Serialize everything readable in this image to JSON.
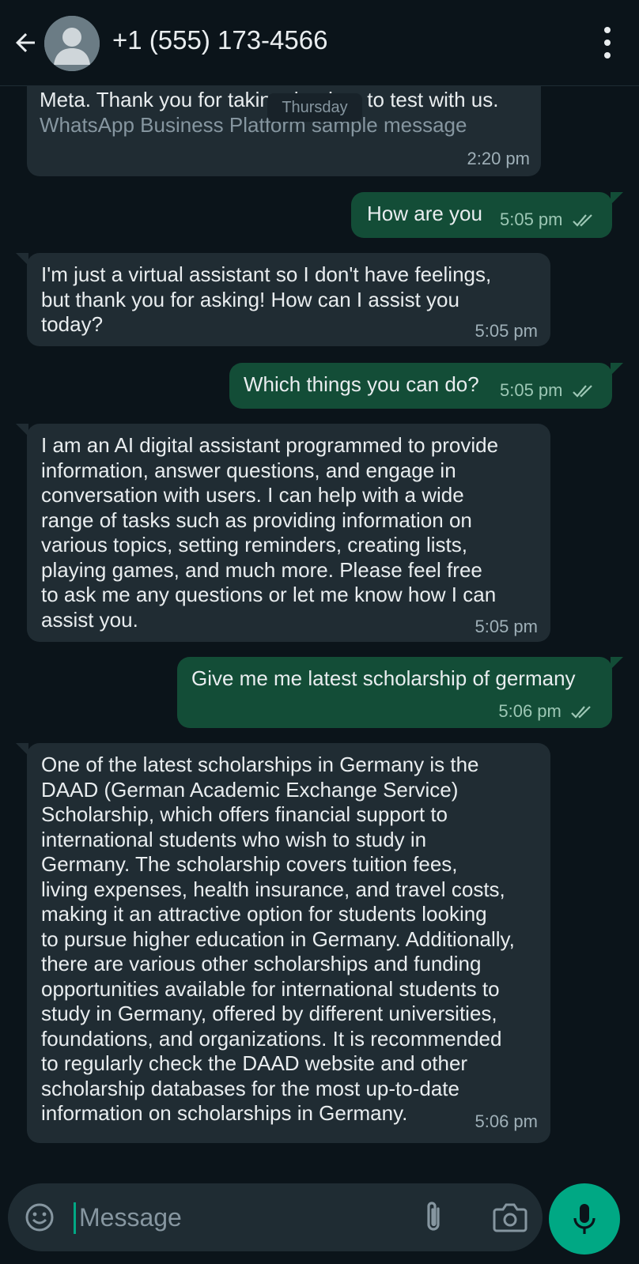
{
  "header": {
    "contact_name": "+1 (555) 173-4566"
  },
  "chat": {
    "date_chip": "Thursday",
    "messages": [
      {
        "direction": "incoming",
        "text_line1": "Meta. Thank you for taking the time to test with us.",
        "text_line2": "WhatsApp Business Platform sample message",
        "time": "2:20 pm"
      },
      {
        "direction": "outgoing",
        "text": "How are you",
        "time": "5:05 pm",
        "status": "read"
      },
      {
        "direction": "incoming",
        "text": "I'm just a virtual assistant so I don't have feelings,\nbut thank you for asking! How can I assist you\ntoday?",
        "time": "5:05 pm"
      },
      {
        "direction": "outgoing",
        "text": "Which things you can do?",
        "time": "5:05 pm",
        "status": "read"
      },
      {
        "direction": "incoming",
        "text": "I am an AI digital assistant programmed to provide\ninformation, answer questions, and engage in\nconversation with users. I can help with a wide\nrange of tasks such as providing information on\nvarious topics, setting reminders, creating lists,\nplaying games, and much more. Please feel free\nto ask me any questions or let me know how I can\nassist you.",
        "time": "5:05 pm"
      },
      {
        "direction": "outgoing",
        "text": "Give me me latest scholarship of germany",
        "time": "5:06 pm",
        "status": "read"
      },
      {
        "direction": "incoming",
        "text": "One of the latest scholarships in Germany is the\nDAAD (German Academic Exchange Service)\nScholarship, which offers financial support to\ninternational students who wish to study in\nGermany. The scholarship covers tuition fees,\nliving expenses, health insurance, and travel costs,\nmaking it an attractive option for students looking\nto pursue higher education in Germany. Additionally,\nthere are various other scholarships and funding\nopportunities available for international students to\nstudy in Germany, offered by different universities,\nfoundations, and organizations. It is recommended\nto regularly check the DAAD website and other\nscholarship databases for the most up-to-date\ninformation on scholarships in Germany.",
        "time": "5:06 pm"
      }
    ]
  },
  "composer": {
    "placeholder": "Message",
    "value": ""
  },
  "icons": {
    "back": "arrow-left-icon",
    "avatar": "default-avatar-icon",
    "menu": "vertical-dots-icon",
    "emoji": "smiley-icon",
    "attach": "paperclip-icon",
    "camera": "camera-icon",
    "mic": "microphone-icon"
  },
  "colors": {
    "background": "#0b141a",
    "incoming_bubble": "#202c33",
    "outgoing_bubble": "#134d37",
    "accent": "#00a884"
  }
}
